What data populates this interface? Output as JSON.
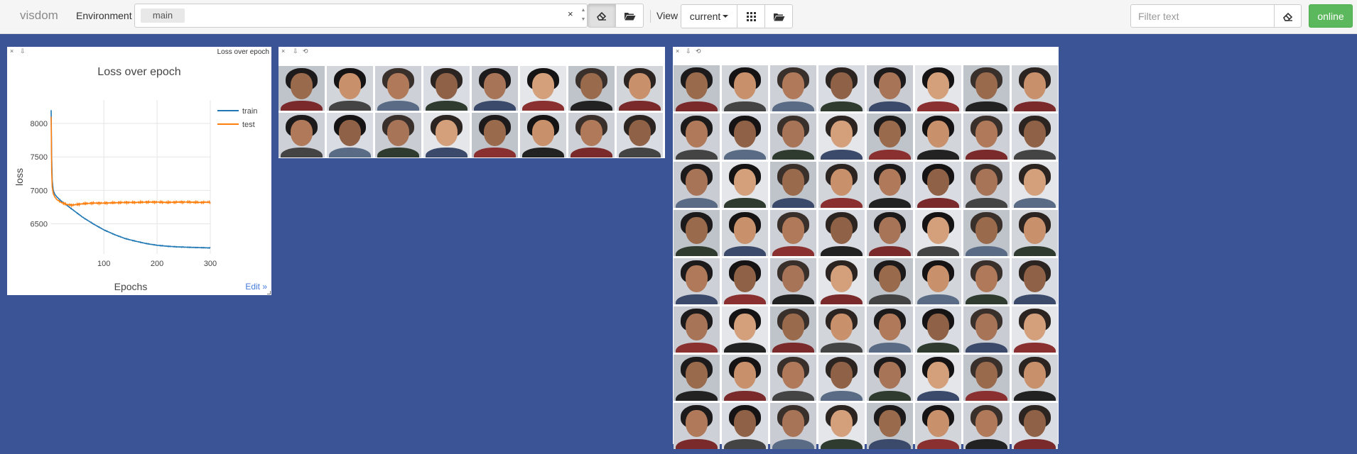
{
  "navbar": {
    "brand": "visdom",
    "environment_label": "Environment",
    "env_chip": "main",
    "clear_symbol": "×",
    "view_label": "View",
    "view_select": "current",
    "filter_placeholder": "Filter text",
    "online_label": "online"
  },
  "icons": {
    "eraser": "eraser-icon",
    "folder": "folder-open-icon",
    "grid": "grid-icon"
  },
  "panes": {
    "loss": {
      "title": "Loss over epoch",
      "edit_label": "Edit »",
      "controls": [
        "×",
        "⇩"
      ]
    },
    "images_small": {
      "controls": [
        "×",
        "⇩",
        "⟲"
      ],
      "rows": 2,
      "cols": 8
    },
    "images_large": {
      "controls": [
        "×",
        "⇩",
        "⟲"
      ],
      "rows": 8,
      "cols": 8
    }
  },
  "chart_data": {
    "type": "line",
    "title": "Loss over epoch",
    "xlabel": "Epochs",
    "ylabel": "loss",
    "xlim": [
      1,
      300
    ],
    "ylim": [
      6050,
      8350
    ],
    "xticks": [
      100,
      200,
      300
    ],
    "yticks": [
      6500,
      7000,
      7500,
      8000
    ],
    "legend_position": "top-right",
    "grid": true,
    "series": [
      {
        "name": "train",
        "color": "#1f77b4",
        "x": [
          1,
          2,
          3,
          5,
          8,
          12,
          20,
          30,
          40,
          50,
          60,
          70,
          80,
          100,
          120,
          140,
          160,
          180,
          200,
          220,
          240,
          260,
          280,
          300
        ],
        "values": [
          8200,
          7500,
          7150,
          7000,
          6940,
          6900,
          6840,
          6780,
          6720,
          6660,
          6600,
          6550,
          6500,
          6410,
          6340,
          6280,
          6240,
          6205,
          6180,
          6165,
          6155,
          6150,
          6145,
          6140
        ]
      },
      {
        "name": "test",
        "color": "#ff7f0e",
        "x": [
          1,
          2,
          3,
          5,
          8,
          12,
          20,
          30,
          40,
          50,
          60,
          80,
          100,
          120,
          140,
          160,
          180,
          200,
          220,
          240,
          260,
          280,
          300
        ],
        "values": [
          8100,
          7300,
          7050,
          6950,
          6900,
          6860,
          6820,
          6790,
          6780,
          6790,
          6800,
          6810,
          6810,
          6815,
          6820,
          6820,
          6825,
          6825,
          6820,
          6825,
          6825,
          6820,
          6825
        ]
      }
    ]
  },
  "colors": {
    "background": "#3a5496",
    "navbar": "#f5f5f5",
    "online": "#5cb85c",
    "link": "#447adb"
  }
}
